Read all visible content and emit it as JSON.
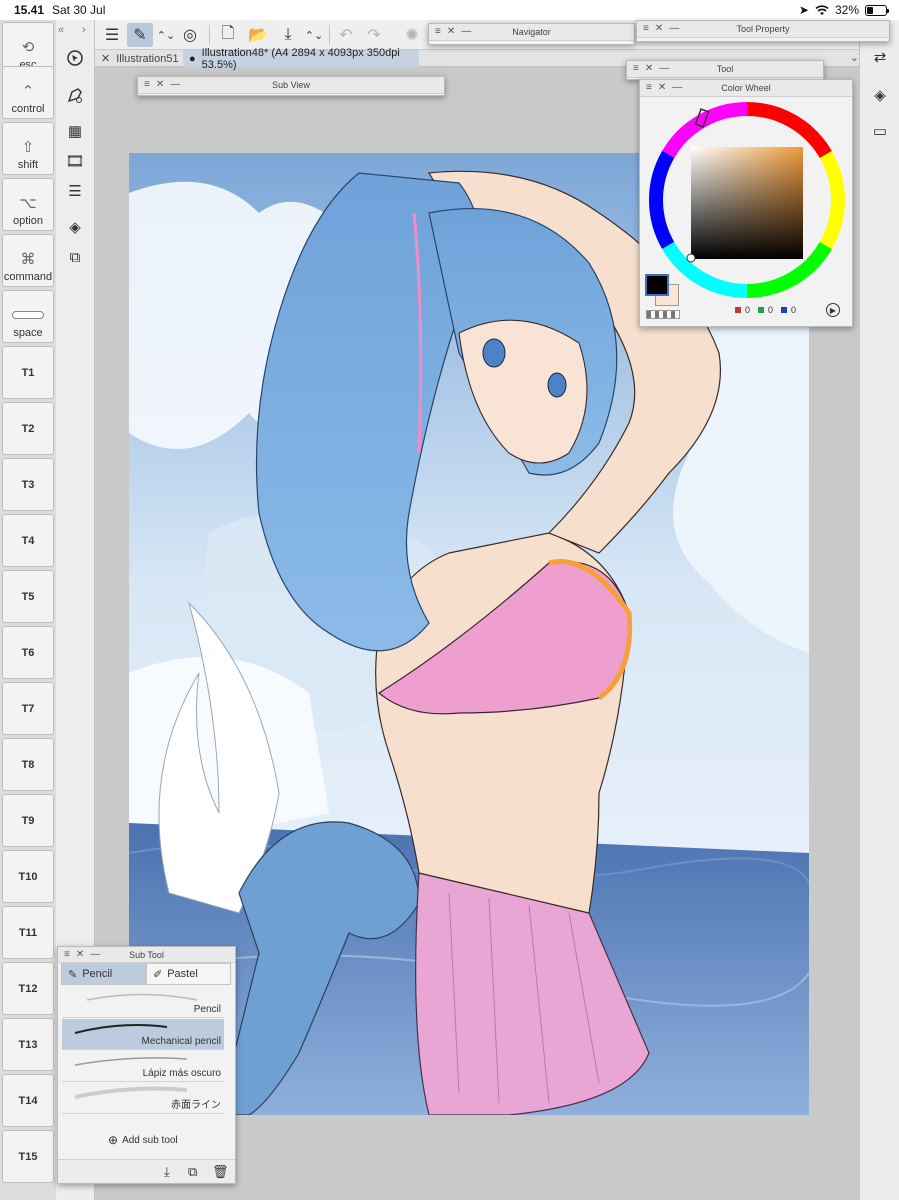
{
  "statusbar": {
    "time": "15.41",
    "date": "Sat 30 Jul",
    "battery": "32%"
  },
  "keys": [
    {
      "label": "esc",
      "icon": "timer-icon"
    },
    {
      "label": "control",
      "icon": "caret-up-icon"
    },
    {
      "label": "shift",
      "icon": "shift-arrow-icon"
    },
    {
      "label": "option",
      "icon": "option-key-icon"
    },
    {
      "label": "command",
      "icon": "command-key-icon"
    },
    {
      "label": "space",
      "icon": "spacebar-icon"
    }
  ],
  "tkeys": [
    "T1",
    "T2",
    "T3",
    "T4",
    "T5",
    "T6",
    "T7",
    "T8",
    "T9",
    "T10",
    "T11",
    "T12",
    "T13",
    "T14",
    "T15"
  ],
  "tabs": {
    "tab1": "Illustration51",
    "tab2": "Illustration48* (A4 2894 x 4093px 350dpi 53.5%)"
  },
  "panels": {
    "navigator": "Navigator",
    "tool_property": "Tool Property",
    "tool": "Tool",
    "color_wheel": "Color Wheel",
    "sub_view": "Sub View",
    "sub_tool": "Sub Tool"
  },
  "color_wheel": {
    "rgb": {
      "r": "0",
      "g": "0",
      "b": "0"
    },
    "main_color": "#000000",
    "sub_color": "#fbe5d4",
    "hue_marker_color": "#f0a040"
  },
  "sub_tool": {
    "tab_pencil": "Pencil",
    "tab_pastel": "Pastel",
    "brushes": [
      "Pencil",
      "Mechanical pencil",
      "Lápiz más oscuro",
      "赤面ライン"
    ],
    "selected_brush": "Mechanical pencil",
    "add_label": "Add sub tool"
  },
  "accent": "#b8c7da"
}
